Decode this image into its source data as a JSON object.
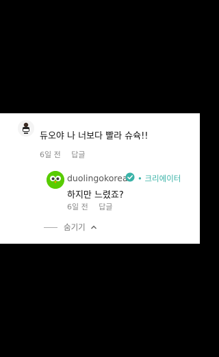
{
  "comment": {
    "text": "듀오야 나 너보다 빨라 슈슉!!",
    "time": "6일 전",
    "reply_label": "답글"
  },
  "reply": {
    "username": "duolingokorea",
    "badge": "크리에이터",
    "text": "하지만 느렸죠?",
    "time": "6일 전",
    "reply_label": "답글"
  },
  "hide_replies_label": "숨기기",
  "colors": {
    "creator_badge": "#3bb3a8",
    "duo_green": "#58cc02"
  }
}
